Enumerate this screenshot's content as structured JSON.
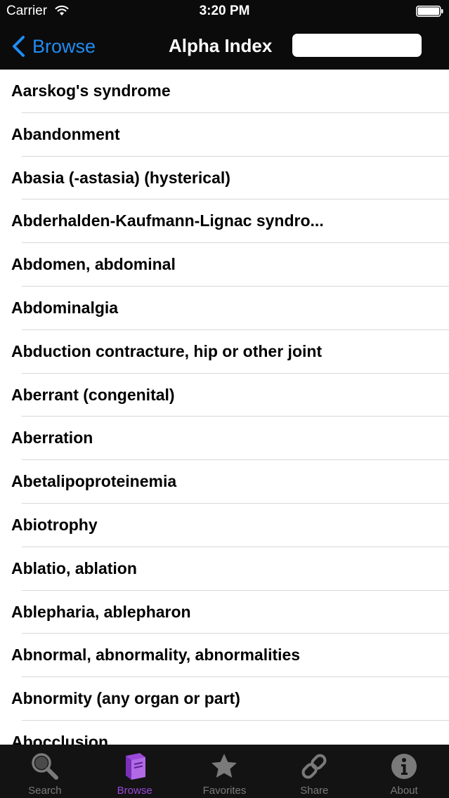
{
  "status_bar": {
    "carrier": "Carrier",
    "time": "3:20 PM"
  },
  "nav": {
    "back_label": "Browse",
    "title": "Alpha Index",
    "search_value": ""
  },
  "list": {
    "items": [
      "Aarskog's syndrome",
      "Abandonment",
      "Abasia (-astasia) (hysterical)",
      "Abderhalden-Kaufmann-Lignac syndro...",
      "Abdomen, abdominal",
      "Abdominalgia",
      "Abduction contracture, hip or other joint",
      "Aberrant (congenital)",
      "Aberration",
      "Abetalipoproteinemia",
      "Abiotrophy",
      "Ablatio, ablation",
      "Ablepharia, ablepharon",
      "Abnormal, abnormality, abnormalities",
      "Abnormity (any organ or part)",
      "Abocclusion"
    ]
  },
  "tabs": [
    {
      "label": "Search",
      "icon": "magnifier-icon"
    },
    {
      "label": "Browse",
      "icon": "book-icon"
    },
    {
      "label": "Favorites",
      "icon": "star-icon"
    },
    {
      "label": "Share",
      "icon": "chain-link-icon"
    },
    {
      "label": "About",
      "icon": "info-icon"
    }
  ],
  "colors": {
    "accent_blue": "#1f8cf4",
    "active_tab_purple": "#9a49d8",
    "inactive_tab_gray": "#7a7a7a",
    "bar_background": "#0b0b0b"
  }
}
